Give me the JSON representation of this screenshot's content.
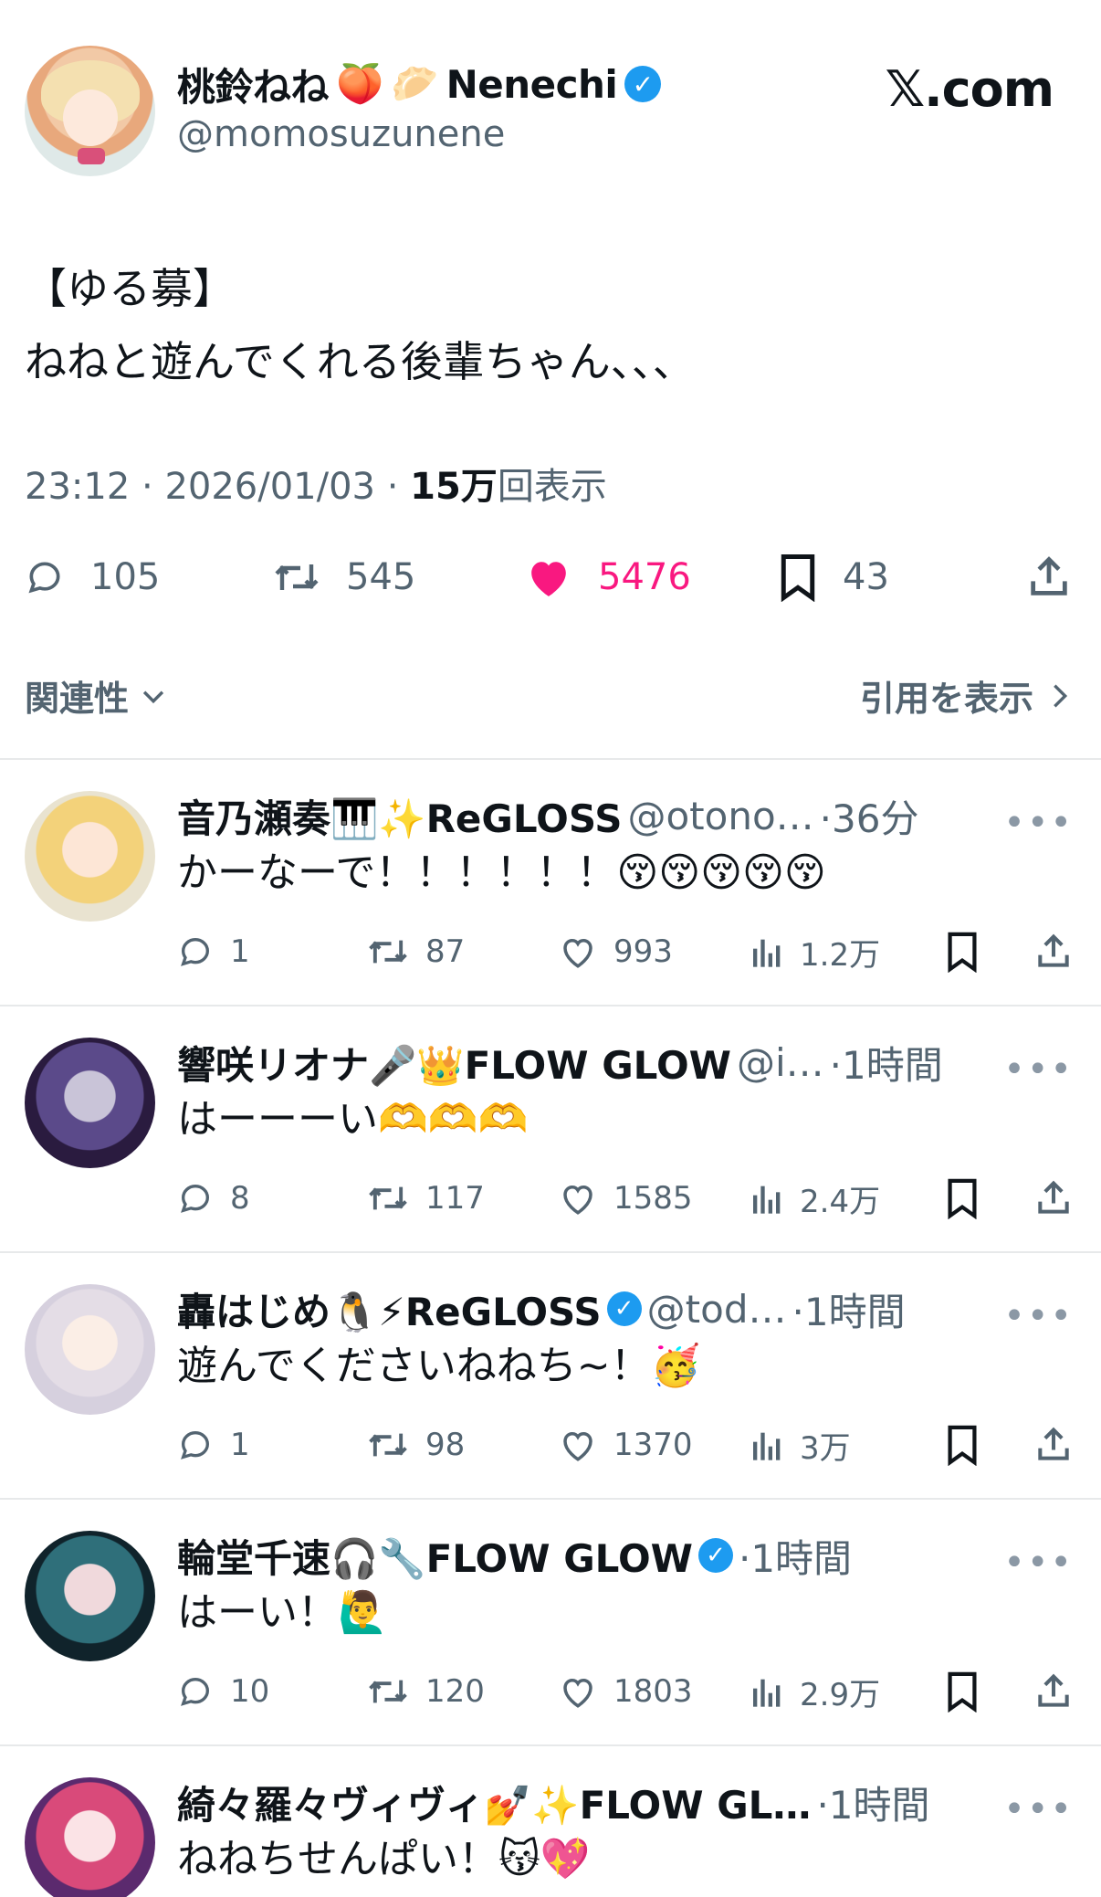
{
  "brand": {
    "site": "𝕏.com"
  },
  "author": {
    "display_name": "桃鈴ねね",
    "name_emojis": [
      "🍑",
      "🥟"
    ],
    "name_suffix": "Nenechi",
    "handle": "@momosuzunene",
    "verified": true
  },
  "tweet": {
    "line1": "【ゆる募】",
    "line2": "ねねと遊んでくれる後輩ちゃん、、、",
    "time": "23:12",
    "date": "2026/01/03",
    "views_count": "15万",
    "views_label": "回表示",
    "replies": "105",
    "retweets": "545",
    "likes": "5476",
    "bookmarks": "43"
  },
  "filters": {
    "sort_label": "関連性",
    "quotes_label": "引用を表示"
  },
  "colors": {
    "accent": "#1d9bf0",
    "like": "#f91880",
    "muted": "#536471",
    "divider": "#e7e9ea"
  },
  "replies": [
    {
      "name": "音乃瀬奏🎹✨ReGLOSS",
      "handle": "@otono…",
      "time": "·36分",
      "verified": false,
      "text": "かーなーで！！！！！！😚😚😚😚😚",
      "replies": "1",
      "retweets": "87",
      "likes": "993",
      "views": "1.2万"
    },
    {
      "name": "響咲リオナ🎤👑FLOW GLOW",
      "handle": "@i…",
      "time": "·1時間",
      "verified": false,
      "text": "はーーーい🫶🫶🫶",
      "replies": "8",
      "retweets": "117",
      "likes": "1585",
      "views": "2.4万"
    },
    {
      "name": "轟はじめ🐧⚡ReGLOSS",
      "handle": "@tod…",
      "time": "·1時間",
      "verified": true,
      "text": "遊んでくださいねねち~！🥳",
      "replies": "1",
      "retweets": "98",
      "likes": "1370",
      "views": "3万"
    },
    {
      "name": "輪堂千速🎧🔧FLOW GLOW",
      "handle": "",
      "time": "·1時間",
      "verified": true,
      "text": "はーい！🙋‍♂️",
      "replies": "10",
      "retweets": "120",
      "likes": "1803",
      "views": "2.9万"
    },
    {
      "name": "綺々羅々ヴィヴィ💅✨FLOW GL…",
      "handle": "",
      "time": "·1時間",
      "verified": false,
      "text": "ねねちせんぱい！😽💖",
      "replies": "",
      "retweets": "",
      "likes": "",
      "views": ""
    }
  ]
}
